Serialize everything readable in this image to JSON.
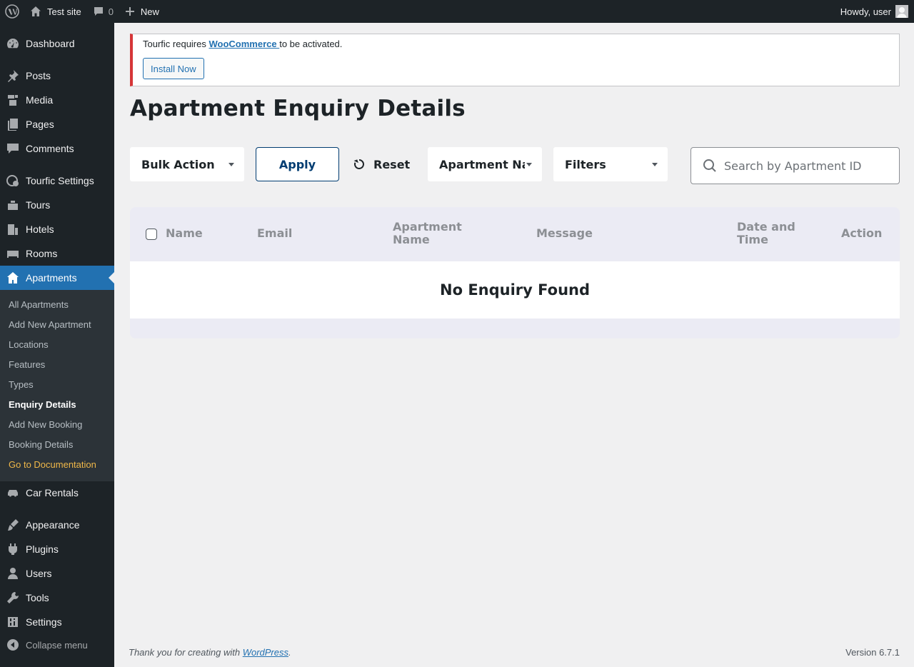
{
  "adminbar": {
    "site_name": "Test site",
    "comments_count": "0",
    "new_label": "New",
    "howdy": "Howdy, user"
  },
  "sidebar": {
    "items": [
      {
        "label": "Dashboard",
        "icon": "dashboard-icon"
      },
      {
        "label": "Posts",
        "icon": "pin-icon"
      },
      {
        "label": "Media",
        "icon": "media-icon"
      },
      {
        "label": "Pages",
        "icon": "pages-icon"
      },
      {
        "label": "Comments",
        "icon": "comment-icon"
      },
      {
        "label": "Tourfic Settings",
        "icon": "tourfic-icon"
      },
      {
        "label": "Tours",
        "icon": "tours-icon"
      },
      {
        "label": "Hotels",
        "icon": "building-icon"
      },
      {
        "label": "Rooms",
        "icon": "bed-icon"
      },
      {
        "label": "Apartments",
        "icon": "home-icon"
      },
      {
        "label": "Car Rentals",
        "icon": "car-icon"
      },
      {
        "label": "Appearance",
        "icon": "brush-icon"
      },
      {
        "label": "Plugins",
        "icon": "plug-icon"
      },
      {
        "label": "Users",
        "icon": "user-icon"
      },
      {
        "label": "Tools",
        "icon": "wrench-icon"
      },
      {
        "label": "Settings",
        "icon": "sliders-icon"
      }
    ],
    "submenu": [
      "All Apartments",
      "Add New Apartment",
      "Locations",
      "Features",
      "Types",
      "Enquiry Details",
      "Add New Booking",
      "Booking Details",
      "Go to Documentation"
    ],
    "collapse_label": "Collapse menu"
  },
  "notice": {
    "prefix": "Tourfic requires ",
    "link": "WooCommerce ",
    "suffix": "to be activated.",
    "button": "Install Now"
  },
  "page": {
    "title": "Apartment Enquiry Details"
  },
  "toolbar": {
    "bulk_action": "Bulk Action",
    "apply": "Apply",
    "reset": "Reset",
    "apartment_select": "Apartment Name",
    "filters": "Filters",
    "search_placeholder": "Search by Apartment ID"
  },
  "table": {
    "columns": [
      "Name",
      "Email",
      "Apartment Name",
      "Message",
      "Date and Time",
      "Action"
    ],
    "empty_message": "No Enquiry Found"
  },
  "footer": {
    "thanks_prefix": "Thank you for creating with ",
    "thanks_link": "WordPress",
    "thanks_suffix": ".",
    "version": "Version 6.7.1"
  },
  "colors": {
    "admin_dark": "#1d2327",
    "accent_blue": "#2271b1",
    "notice_red": "#d63638",
    "doc_link": "#f0b849"
  }
}
